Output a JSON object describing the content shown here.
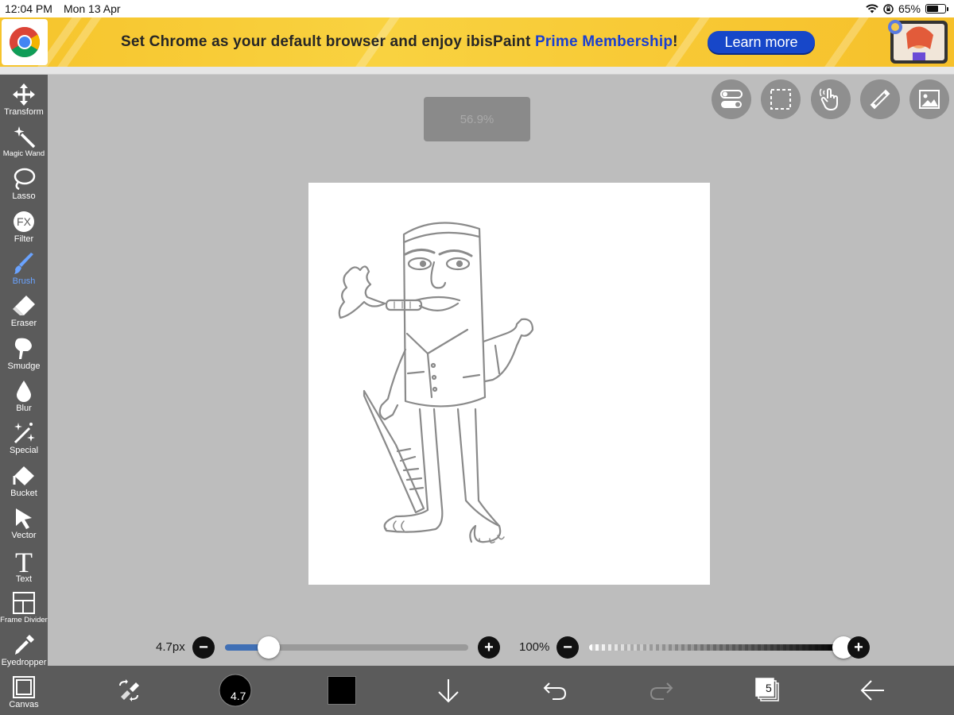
{
  "status_bar": {
    "time": "12:04 PM",
    "date": "Mon 13 Apr",
    "battery": "65%",
    "battery_level": 0.65
  },
  "banner": {
    "text_before": "Set Chrome as your default browser and enjoy ibisPaint ",
    "text_highlight": "Prime Membership",
    "text_after": "!",
    "button_label": "Learn more",
    "button_color": "#1747c9"
  },
  "zoom_indicator": "56.9%",
  "tools": [
    {
      "label": "Transform",
      "icon": "move-arrows-icon"
    },
    {
      "label": "Magic Wand",
      "icon": "magic-wand-icon"
    },
    {
      "label": "Lasso",
      "icon": "lasso-icon"
    },
    {
      "label": "Filter",
      "icon": "fx-icon"
    },
    {
      "label": "Brush",
      "icon": "brush-icon",
      "active": true
    },
    {
      "label": "Eraser",
      "icon": "eraser-icon"
    },
    {
      "label": "Smudge",
      "icon": "smudge-icon"
    },
    {
      "label": "Blur",
      "icon": "blur-drop-icon"
    },
    {
      "label": "Special",
      "icon": "special-sparkle-icon"
    },
    {
      "label": "Bucket",
      "icon": "bucket-icon"
    },
    {
      "label": "Vector",
      "icon": "vector-arrow-icon"
    },
    {
      "label": "Text",
      "icon": "text-t-icon"
    },
    {
      "label": "Frame Divider",
      "icon": "frame-divider-icon"
    },
    {
      "label": "Eyedropper",
      "icon": "eyedropper-icon"
    },
    {
      "label": "Canvas",
      "icon": "canvas-icon"
    }
  ],
  "brush_size": {
    "label": "4.7px",
    "level": 0.18,
    "indicator": "4.7"
  },
  "opacity": {
    "label": "100%",
    "level": 1.0
  },
  "layers_count": "5",
  "colors": {
    "toolbar": "#5b5b5b",
    "workspace": "#bdbdbd",
    "active_tool": "#6aa3ff",
    "current_color": "#000000",
    "slider_fill": "#3f6fb5"
  }
}
